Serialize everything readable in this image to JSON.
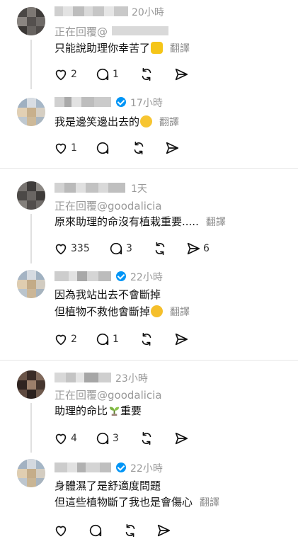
{
  "colors": {
    "verified": "#0095f6",
    "muted_text": "#999999",
    "divider": "#e6e6e6"
  },
  "comments": [
    {
      "time": "20小時",
      "reply_prefix": "正在回覆@",
      "text": "只能說助理你幸苦了",
      "translate": "翻譯",
      "like_count": "2",
      "reply_count": "1",
      "repost_count": "",
      "share_count": ""
    },
    {
      "time": "17小時",
      "text": "我是邊笑邊出去的",
      "translate": "翻譯",
      "like_count": "1",
      "reply_count": "",
      "repost_count": "",
      "share_count": ""
    },
    {
      "time": "1天",
      "reply_prefix": "正在回覆@goodalicia",
      "text": "原來助理的命沒有植栽重要.....",
      "translate": "翻譯",
      "like_count": "335",
      "reply_count": "3",
      "repost_count": "",
      "share_count": "6"
    },
    {
      "time": "22小時",
      "text_line1": "因為我站出去不會斷掉",
      "text_line2": "但植物不救他會斷掉",
      "translate": "翻譯",
      "like_count": "2",
      "reply_count": "1",
      "repost_count": "",
      "share_count": ""
    },
    {
      "time": "23小時",
      "reply_prefix": "正在回覆@goodalicia",
      "text_before": "助理的命比",
      "text_after": "重要",
      "translate": "",
      "like_count": "4",
      "reply_count": "3",
      "repost_count": "",
      "share_count": ""
    },
    {
      "time": "22小時",
      "text_line1": "身體濕了是舒適度問題",
      "text_line2": "但這些植物斷了我也是會傷心",
      "translate": "翻譯",
      "like_count": "",
      "reply_count": "",
      "repost_count": "",
      "share_count": ""
    }
  ],
  "icons": {
    "like": "heart-icon",
    "reply": "comment-bubble-icon",
    "repost": "repost-icon",
    "share": "send-icon",
    "verified": "verified-badge-icon"
  }
}
